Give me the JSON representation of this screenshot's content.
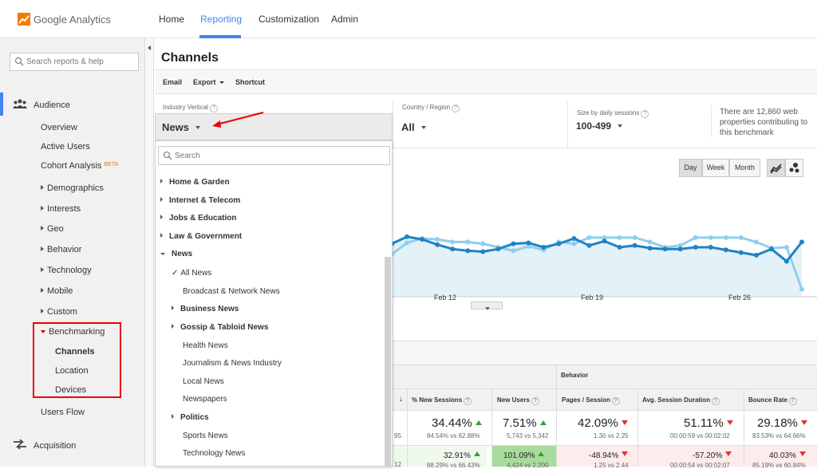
{
  "app": {
    "name_a": "Google",
    "name_b": "Analytics"
  },
  "topnav": [
    "Home",
    "Reporting",
    "Customization",
    "Admin"
  ],
  "sidebar": {
    "search_placeholder": "Search reports & help",
    "audience": "Audience",
    "items": [
      "Overview",
      "Active Users",
      "Cohort Analysis",
      "Demographics",
      "Interests",
      "Geo",
      "Behavior",
      "Technology",
      "Mobile",
      "Custom",
      "Benchmarking",
      "Channels",
      "Location",
      "Devices",
      "Users Flow"
    ],
    "beta": "BETA",
    "acquisition": "Acquisition"
  },
  "page": {
    "title": "Channels",
    "actions": [
      "Email",
      "Export",
      "Shortcut"
    ]
  },
  "filters": {
    "industry_label": "Industry Vertical",
    "industry_value": "News",
    "country_label": "Country / Region",
    "country_value": "All",
    "size_label": "Size by daily sessions",
    "size_value": "100-499",
    "note": "There are 12,860 web properties contributing to this benchmark",
    "qmark": "?"
  },
  "dropdown": {
    "search_placeholder": "Search",
    "categories": [
      "Home & Garden",
      "Internet & Telecom",
      "Jobs & Education",
      "Law & Government",
      "News"
    ],
    "news_children": [
      "All News",
      "Broadcast & Network News",
      "Business News",
      "Gossip & Tabloid News",
      "Health News",
      "Journalism & News Industry",
      "Local News",
      "Newspapers",
      "Politics",
      "Sports News",
      "Technology News"
    ]
  },
  "chart_controls": {
    "day": "Day",
    "week": "Week",
    "month": "Month"
  },
  "chart_data": {
    "type": "line",
    "x_ticks": [
      "Feb 12",
      "Feb 19",
      "Feb 26"
    ],
    "series": [
      {
        "values": [
          1.5,
          2,
          6,
          4.5,
          1.5,
          -1,
          -2,
          -2.5,
          -1,
          2,
          2.5,
          0,
          2,
          5,
          1,
          3.5,
          0,
          1,
          -0.5,
          -1,
          -1,
          0,
          0,
          -1.5,
          -3,
          -4.5,
          -1,
          -8,
          3
        ]
      },
      {
        "values": [
          2.5,
          -4,
          2.5,
          5,
          4.5,
          3,
          3,
          2,
          0,
          -2,
          0.5,
          -1.5,
          3,
          2,
          5.5,
          5.5,
          5.5,
          5.5,
          3,
          0,
          1,
          5.5,
          5.5,
          5.5,
          5.5,
          3,
          -0.5,
          0,
          -24
        ]
      }
    ],
    "colors": [
      "#1f83c2",
      "#8fcfee"
    ]
  },
  "table": {
    "group_label": "Behavior",
    "headers": [
      "% New Sessions",
      "New Users",
      "Pages / Session",
      "Avg. Session Duration",
      "Bounce Rate"
    ],
    "row1": [
      {
        "value": "34.44%",
        "sub": "84.54% vs 62.88%",
        "dir": "up"
      },
      {
        "value": "7.51%",
        "sub": "5,743 vs 5,342",
        "dir": "up"
      },
      {
        "value": "42.09%",
        "sub": "1.30 vs 2.25",
        "dir": "down"
      },
      {
        "value": "51.11%",
        "sub": "00:00:59 vs 00:02:02",
        "dir": "down"
      },
      {
        "value": "29.18%",
        "sub": "83.53% vs 64.66%",
        "dir": "down"
      }
    ],
    "row1_left_fragment": "95",
    "row2": [
      {
        "value": "32.91%",
        "sub": "88.29% vs 66.43%",
        "dir": "up"
      },
      {
        "value": "101.09%",
        "sub": "4,424 vs 2,200",
        "dir": "up"
      },
      {
        "value": "-48.94%",
        "sub": "1.25 vs 2.44",
        "dir": "down"
      },
      {
        "value": "-57.20%",
        "sub": "00:00:54 vs 00:02:07",
        "dir": "down"
      },
      {
        "value": "40.03%",
        "sub": "85.19% vs 60.84%",
        "dir": "down"
      }
    ],
    "row2_left_fragment": "12"
  }
}
